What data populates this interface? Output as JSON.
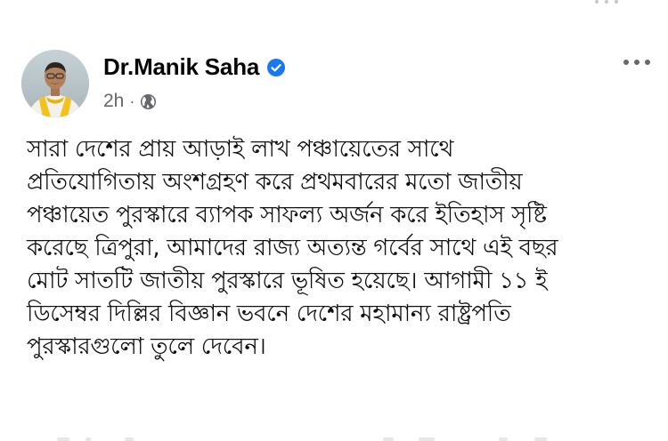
{
  "post": {
    "author": "Dr.Manik Saha",
    "verified": true,
    "timestamp": "2h",
    "separator": "·",
    "audience_icon": "globe-icon",
    "menu_icon": "more-options-icon",
    "lines": [
      "সারা দেশের প্রায় আড়াই লাখ পঞ্চায়েতের সাথে",
      "প্রতিযোগিতায় অংশগ্রহণ করে প্রথমবারের মতো জাতীয়",
      "পঞ্চায়েত পুরস্কারে ব্যাপক সাফল্য অর্জন করে ইতিহাস সৃষ্টি",
      "করেছে ত্রিপুরা, আমাদের রাজ্য অত্যন্ত গর্বের সাথে এই বছর",
      "মোট সাতটি জাতীয় পুরস্কারে ভূষিত হয়েছে। আগামী ১১ ই",
      "ডিসেম্বর দিল্লির বিজ্ঞান ভবনে দেশের মহামান্য রাষ্ট্রপতি",
      "পুরস্কারগুলো তুলে দেবেন।"
    ]
  },
  "colors": {
    "name": "#050505",
    "meta": "#65676b",
    "verified_badge": "#1877f2",
    "text": "#101010"
  }
}
